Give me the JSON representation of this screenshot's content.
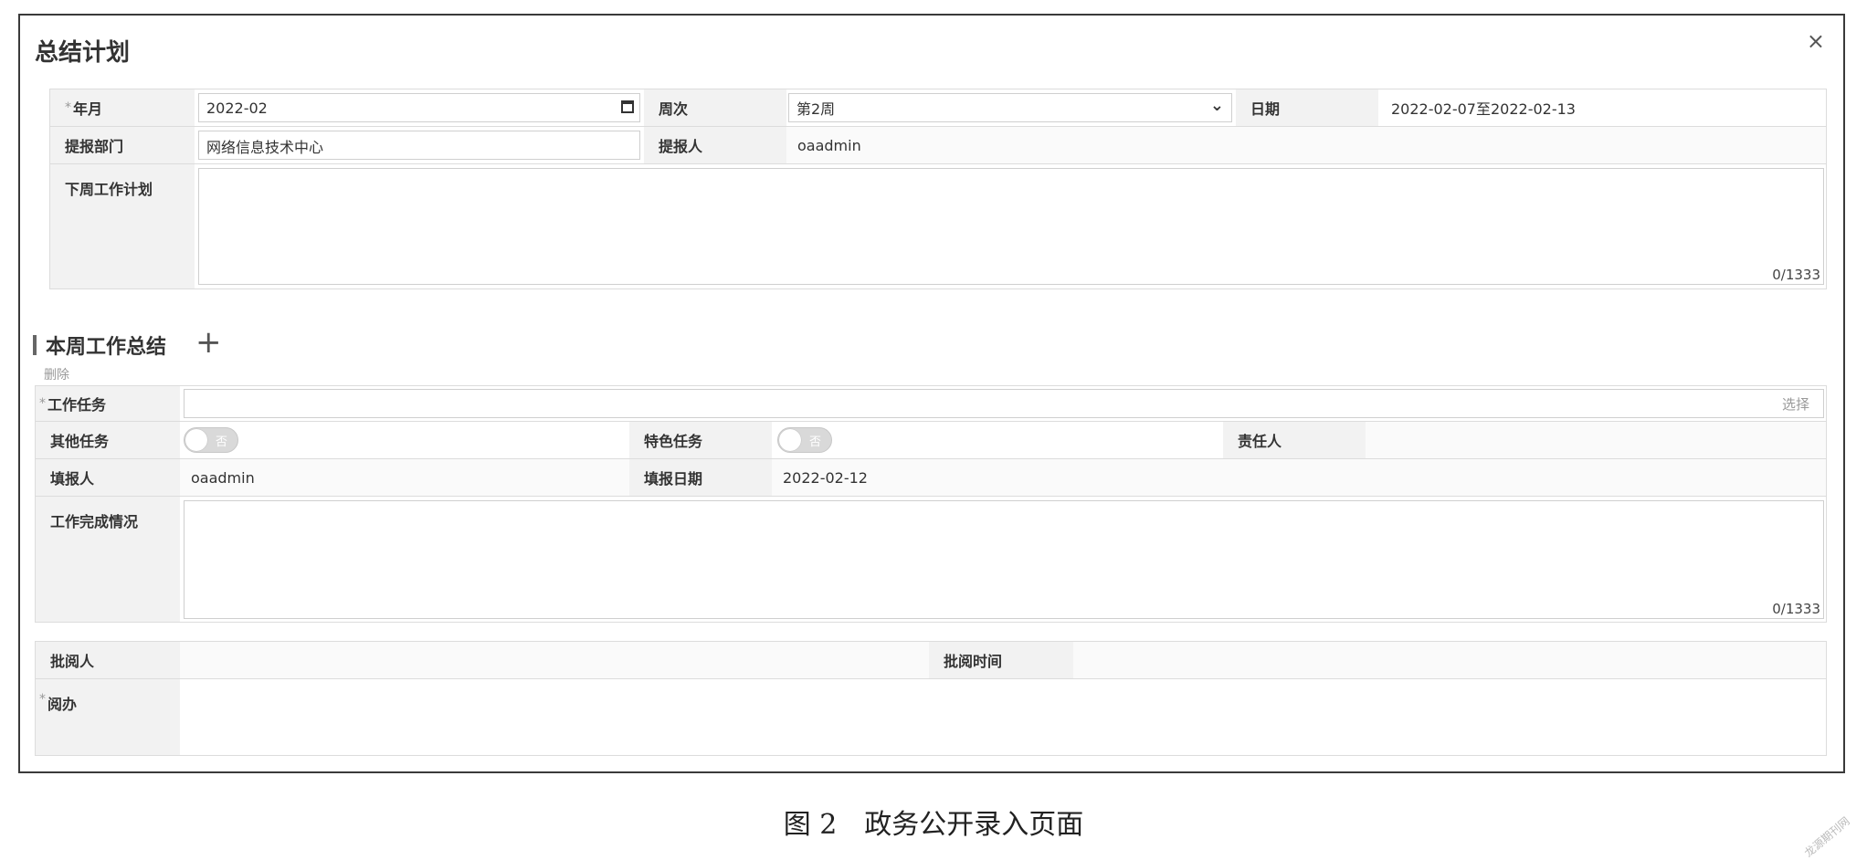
{
  "dialog": {
    "title": "总结计划",
    "close": "×"
  },
  "plan": {
    "year_month_label": "年月",
    "year_month_value": "2022-02",
    "week_label": "周次",
    "week_value": "第2周",
    "date_label": "日期",
    "date_value": "2022-02-07至2022-02-13",
    "dept_label": "提报部门",
    "dept_value": "网络信息技术中心",
    "reporter_label": "提报人",
    "reporter_value": "oaadmin",
    "next_plan_label": "下周工作计划",
    "next_plan_counter": "0/1333"
  },
  "summary": {
    "section_title": "本周工作总结",
    "add_icon": "plus-icon",
    "delete_label": "删除",
    "task_label": "工作任务",
    "task_select": "选择",
    "other_task_label": "其他任务",
    "other_task_toggle": "否",
    "special_task_label": "特色任务",
    "special_task_toggle": "否",
    "owner_label": "责任人",
    "filler_label": "填报人",
    "filler_value": "oaadmin",
    "fill_date_label": "填报日期",
    "fill_date_value": "2022-02-12",
    "completion_label": "工作完成情况",
    "completion_counter": "0/1333"
  },
  "review": {
    "reviewer_label": "批阅人",
    "review_time_label": "批阅时间",
    "handle_label": "阅办"
  },
  "caption": "图 2　政务公开录入页面",
  "watermark": "龙源期刊网"
}
